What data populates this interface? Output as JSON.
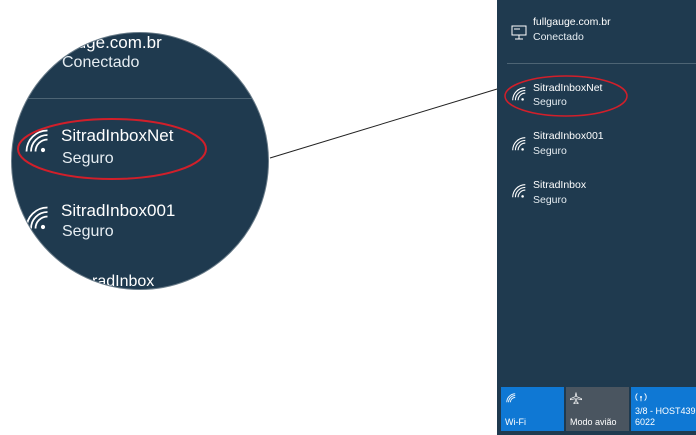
{
  "connected_network": {
    "name": "fullgauge.com.br",
    "status": "Conectado"
  },
  "networks": [
    {
      "name": "SitradInboxNet",
      "status": "Seguro",
      "highlighted": true
    },
    {
      "name": "SitradInbox001",
      "status": "Seguro"
    },
    {
      "name": "SitradInbox",
      "status": "Seguro"
    }
  ],
  "zoom": {
    "partial_connected_name": "ıuge.com.br",
    "connected_status": "Conectado",
    "net1_name": "SitradInboxNet",
    "net1_status": "Seguro",
    "net2_name": "SitradInbox001",
    "net2_status": "Seguro",
    "net3_partial_name": "radInbox"
  },
  "quick_actions": {
    "wifi_label": "Wi-Fi",
    "airplane_label": "Modo avião",
    "hotspot_line1": "3/8 - HOST439",
    "hotspot_line2": "6022"
  },
  "colors": {
    "panel_bg": "#1f3a4f",
    "accent": "#0f78d4",
    "highlight_ring": "#d11f2a",
    "tile_inactive": "#4a5560"
  },
  "icons": {
    "connected": "wired-network-icon",
    "wifi": "wifi-signal-icon",
    "airplane": "airplane-icon",
    "hotspot": "mobile-hotspot-icon"
  }
}
